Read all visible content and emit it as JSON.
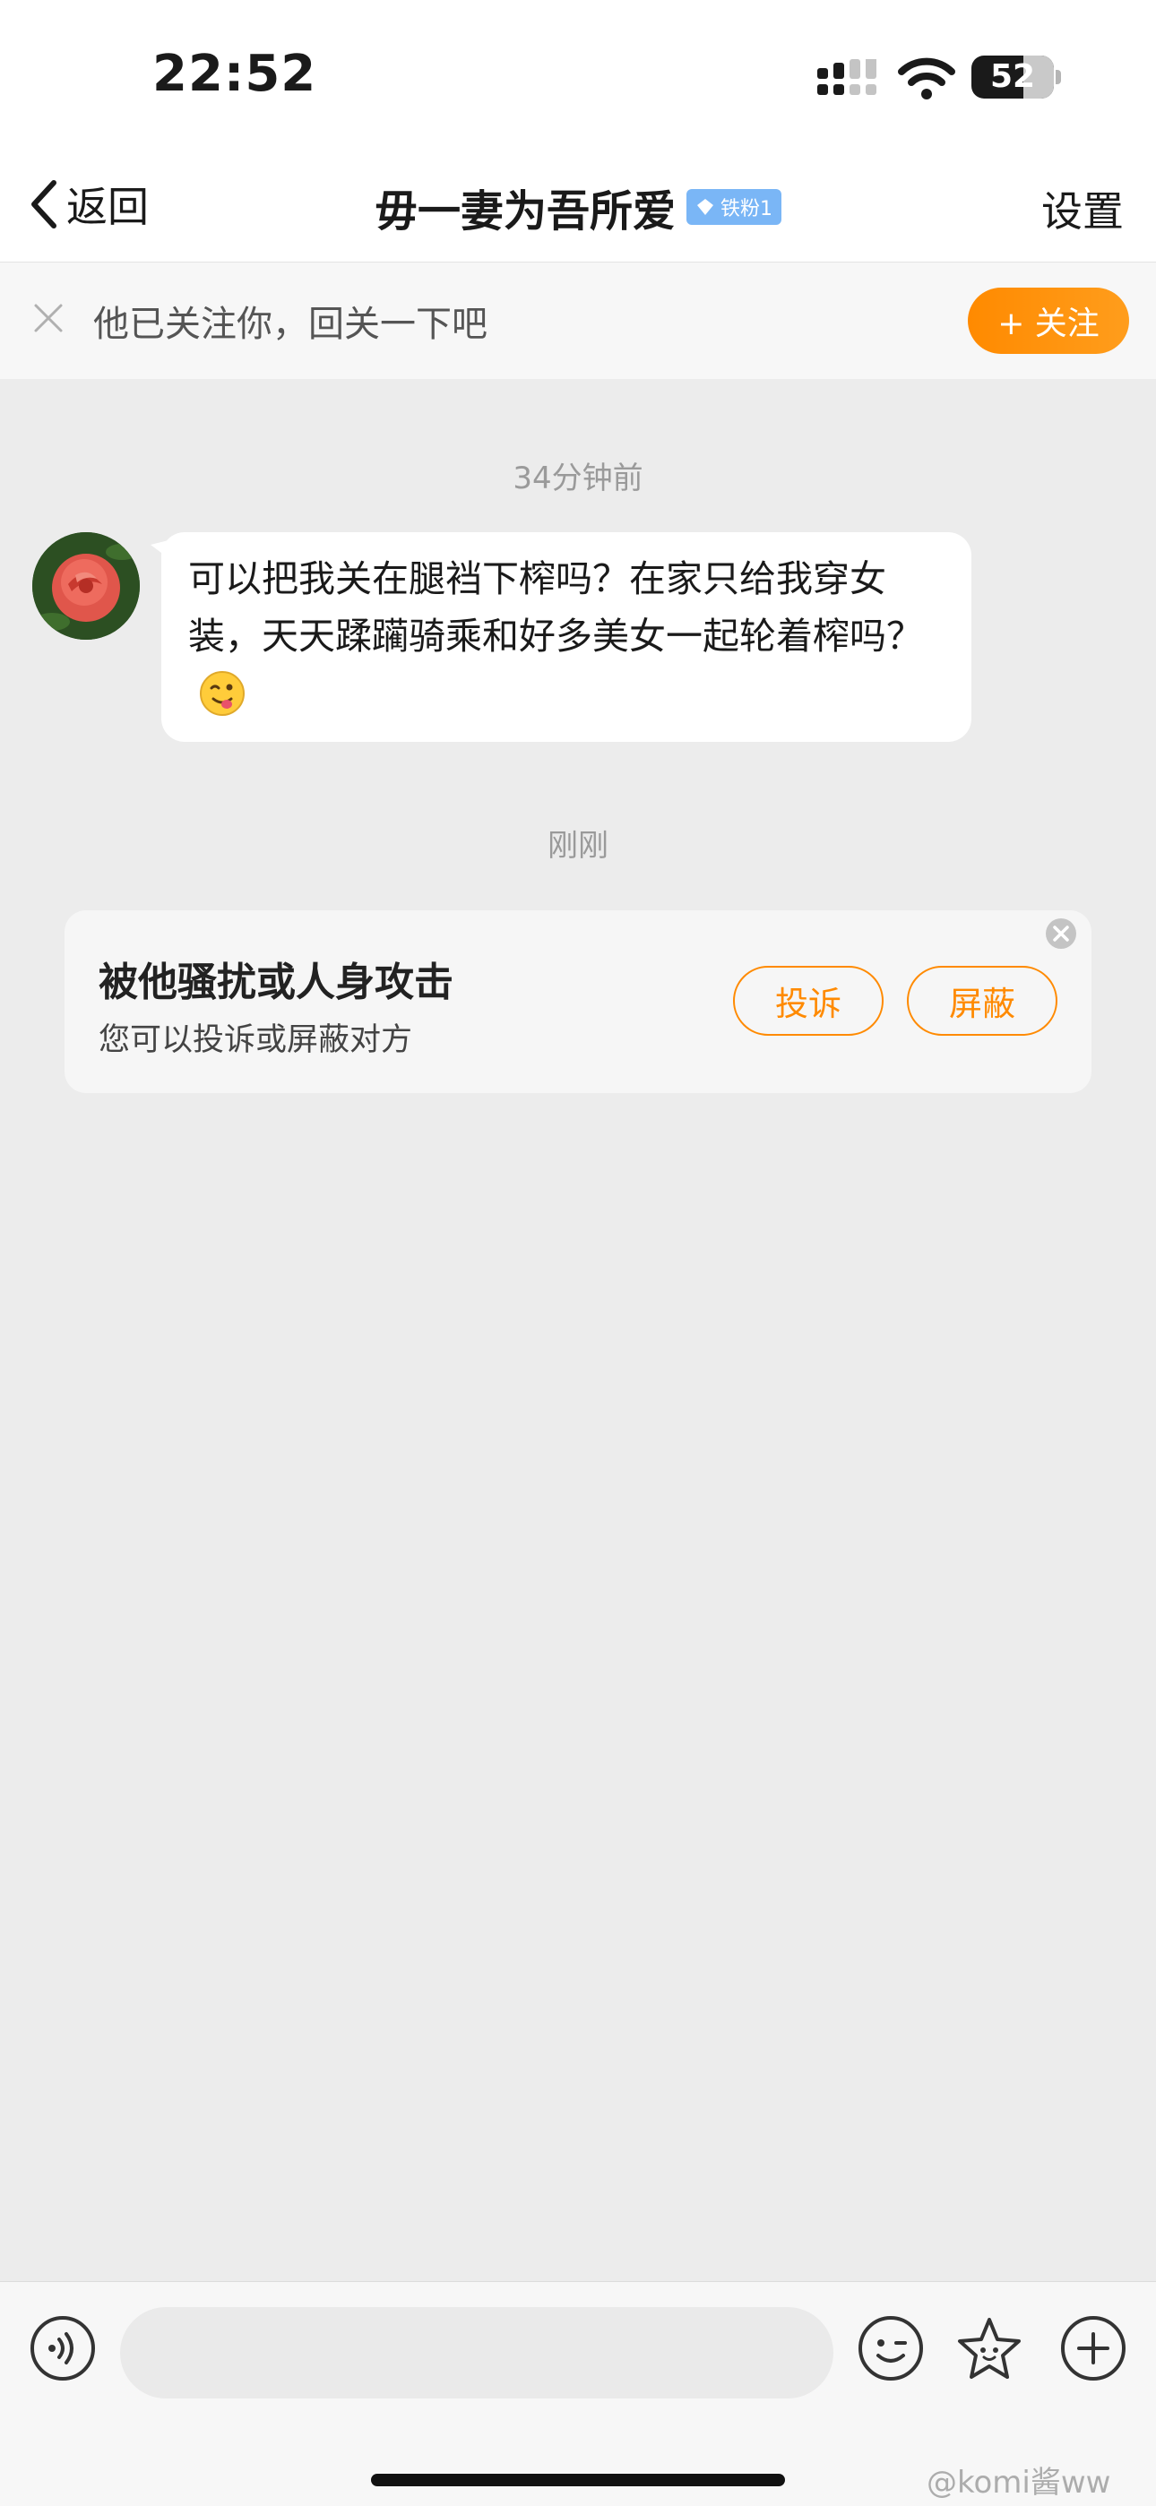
{
  "status_bar": {
    "time": "22:52",
    "battery": "52"
  },
  "nav": {
    "back_label": "返回",
    "title": "毋一妻为吾所爱",
    "badge": "铁粉1",
    "settings_label": "设置"
  },
  "follow_bar": {
    "message": "他已关注你，回关一下吧",
    "button_label": "+ 关注"
  },
  "chat": {
    "timestamp_1": "34分钟前",
    "message_1": "可以把我关在腿裆下榨吗？在家只给我穿女装，天天蹂躏骑乘和好多美女一起轮着榨吗？",
    "message_1_emoji": "drooling-face-emoji",
    "timestamp_2": "刚刚"
  },
  "harassment_card": {
    "title": "被他骚扰或人身攻击",
    "subtitle": "您可以投诉或屏蔽对方",
    "report_label": "投诉",
    "block_label": "屏蔽"
  },
  "watermark": "@komi酱ww",
  "colors": {
    "accent": "#ff8a00",
    "badge": "#7ab6f6",
    "chat_bg": "#ececec"
  },
  "icons": [
    "signal-icon",
    "wifi-icon",
    "battery-icon",
    "back-chevron-icon",
    "diamond-icon",
    "close-icon",
    "voice-icon",
    "emoji-icon",
    "sticker-star-icon",
    "plus-icon"
  ]
}
